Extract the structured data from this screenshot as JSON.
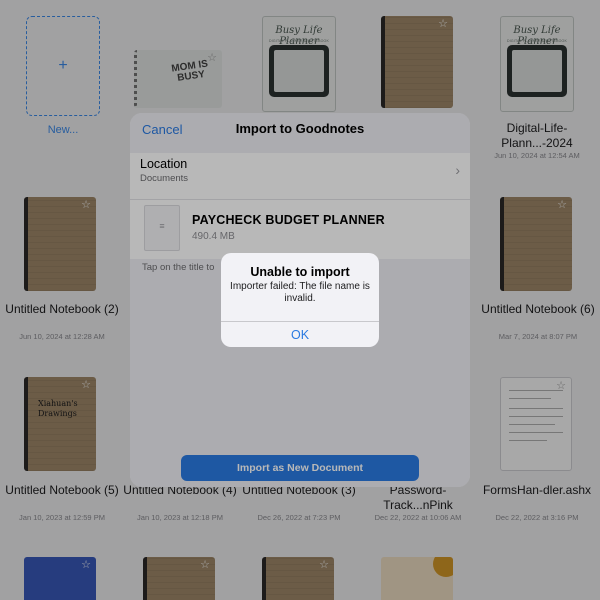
{
  "library": {
    "new_label": "New...",
    "row1": [
      {
        "title": "Busy Life Planner",
        "subtitle": "DIGITAL PLANNER & NOTEBOOK"
      },
      {
        "cover_text": "MOM IS BUSY"
      },
      {
        "title": "Busy Life Planner",
        "subtitle": "DIGITAL PLANNER & NOTEBOOK"
      }
    ],
    "digital_life_label": "Digital-Life-Plann...-2024",
    "digital_life_date": "Jun 10, 2024 at 12:54 AM",
    "notebooks": [
      {
        "label": "Untitled Notebook (2)",
        "date": "Jun 10, 2024 at 12:28 AM"
      },
      {
        "label": "Untitled Notebook (6)",
        "date": "Mar 7, 2024 at 8:07 PM"
      },
      {
        "label": "Untitled Notebook (5)",
        "date": "Jan 10, 2023 at 12:59 PM"
      },
      {
        "label": "Untitled Notebook (4)",
        "date": "Jan 10, 2023 at 12:18 PM"
      },
      {
        "label": "Untitled Notebook (3)",
        "date": "Dec 26, 2022 at 7:23 PM"
      },
      {
        "label": "Password-Track...nPink",
        "date": "Dec 22, 2022 at 10:06 AM"
      },
      {
        "label": "FormsHan-dler.ashx",
        "date": "Dec 22, 2022 at 3:16 PM"
      }
    ],
    "scribble": "Xiahuan's Drawings"
  },
  "import_sheet": {
    "cancel": "Cancel",
    "title": "Import to Goodnotes",
    "location_label": "Location",
    "location_value": "Documents",
    "file_name": "PAYCHECK BUDGET PLANNER",
    "file_size": "490.4 MB",
    "hint": "Tap on the title to",
    "import_button": "Import as New Document"
  },
  "alert": {
    "title": "Unable to import",
    "message": "Importer failed: The file name is invalid.",
    "ok": "OK"
  },
  "colors": {
    "accent": "#2a7ae2",
    "notebook_cover": "#a48c6c"
  }
}
